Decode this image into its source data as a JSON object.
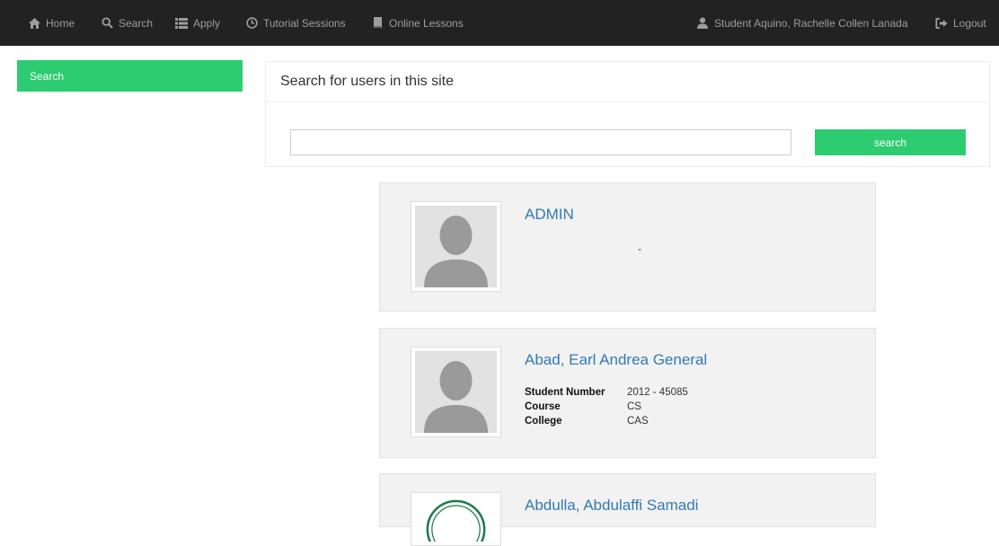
{
  "navbar": {
    "items": [
      {
        "label": "Home",
        "icon": "home-icon"
      },
      {
        "label": "Search",
        "icon": "search-icon"
      },
      {
        "label": "Apply",
        "icon": "list-icon"
      },
      {
        "label": "Tutorial Sessions",
        "icon": "clock-icon"
      },
      {
        "label": "Online Lessons",
        "icon": "book-icon"
      }
    ],
    "user": {
      "label": "Student Aquino, Rachelle Collen Lanada",
      "icon": "user-icon"
    },
    "logout": {
      "label": "Logout",
      "icon": "logout-icon"
    }
  },
  "sidebar": {
    "search_label": "Search"
  },
  "search_panel": {
    "heading": "Search for users in this site",
    "input_value": "",
    "button_label": "search"
  },
  "results": [
    {
      "name": "ADMIN",
      "note": "-"
    },
    {
      "name": "Abad, Earl Andrea General",
      "fields": [
        {
          "label": "Student Number",
          "value": "2012 - 45085"
        },
        {
          "label": "Course",
          "value": "CS"
        },
        {
          "label": "College",
          "value": "CAS"
        }
      ]
    },
    {
      "name": "Abdulla, Abdulaffi Samadi"
    }
  ],
  "colors": {
    "navbar_bg": "#222222",
    "nav_text": "#9d9d9d",
    "accent_green": "#2ecc71",
    "link_blue": "#337ab7",
    "card_bg": "#f2f2f2"
  }
}
